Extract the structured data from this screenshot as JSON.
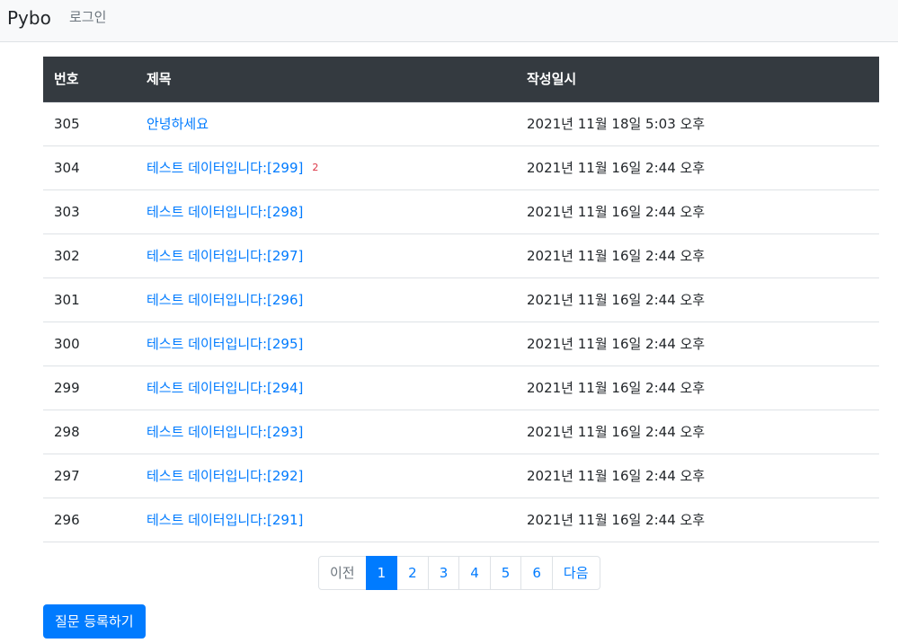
{
  "navbar": {
    "brand": "Pybo",
    "login": "로그인"
  },
  "table": {
    "headers": [
      "번호",
      "제목",
      "작성일시"
    ],
    "rows": [
      {
        "num": "305",
        "subject": "안녕하세요",
        "answers": "",
        "date": "2021년 11월 18일 5:03 오후"
      },
      {
        "num": "304",
        "subject": "테스트 데이터입니다:[299]",
        "answers": "2",
        "date": "2021년 11월 16일 2:44 오후"
      },
      {
        "num": "303",
        "subject": "테스트 데이터입니다:[298]",
        "answers": "",
        "date": "2021년 11월 16일 2:44 오후"
      },
      {
        "num": "302",
        "subject": "테스트 데이터입니다:[297]",
        "answers": "",
        "date": "2021년 11월 16일 2:44 오후"
      },
      {
        "num": "301",
        "subject": "테스트 데이터입니다:[296]",
        "answers": "",
        "date": "2021년 11월 16일 2:44 오후"
      },
      {
        "num": "300",
        "subject": "테스트 데이터입니다:[295]",
        "answers": "",
        "date": "2021년 11월 16일 2:44 오후"
      },
      {
        "num": "299",
        "subject": "테스트 데이터입니다:[294]",
        "answers": "",
        "date": "2021년 11월 16일 2:44 오후"
      },
      {
        "num": "298",
        "subject": "테스트 데이터입니다:[293]",
        "answers": "",
        "date": "2021년 11월 16일 2:44 오후"
      },
      {
        "num": "297",
        "subject": "테스트 데이터입니다:[292]",
        "answers": "",
        "date": "2021년 11월 16일 2:44 오후"
      },
      {
        "num": "296",
        "subject": "테스트 데이터입니다:[291]",
        "answers": "",
        "date": "2021년 11월 16일 2:44 오후"
      }
    ]
  },
  "pagination": {
    "prev": "이전",
    "pages": [
      "1",
      "2",
      "3",
      "4",
      "5",
      "6"
    ],
    "current": "1",
    "next": "다음"
  },
  "actions": {
    "create_question": "질문 등록하기"
  },
  "colors": {
    "primary": "#007bff",
    "header_bg": "#343a40",
    "navbar_bg": "#f8f9fa",
    "badge": "#dc3545"
  }
}
